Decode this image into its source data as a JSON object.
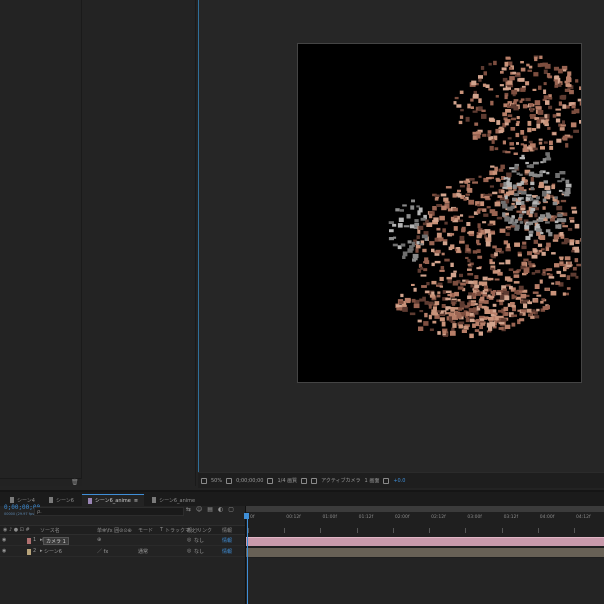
{
  "timeline": {
    "tabs": [
      {
        "label": "シーン4",
        "color": "#7a7a7a",
        "active": false
      },
      {
        "label": "シーン6",
        "color": "#7a7a7a",
        "active": false
      },
      {
        "label": "シーン6_anime",
        "color": "#9a86b5",
        "active": true
      },
      {
        "label": "シーン6_anime",
        "color": "#7a7a7a",
        "active": false
      }
    ],
    "timecode": "0;00;00;00",
    "fps": "00000 (29.97 fps)",
    "search_placeholder": "ρ.",
    "columns": [
      "ソース名",
      "单✻\\fx 囲⊘⊙⊕",
      "モード",
      "T",
      "トラックマット",
      "親とリンク",
      "情報"
    ],
    "layers": [
      {
        "index": "1",
        "name": "カメラ 1",
        "label_color": "#b07070",
        "mode": "",
        "parent": "なし",
        "info": "情報",
        "selected": true
      },
      {
        "index": "2",
        "name": "シーン6",
        "label_color": "#b8a47a",
        "mode": "通常",
        "parent": "なし",
        "info": "情報",
        "switch": "／ fx"
      }
    ],
    "ruler_ticks": [
      "0f",
      "00:12f",
      "01:00f",
      "01:12f",
      "02:00f",
      "02:12f",
      "03:00f",
      "03:12f",
      "04:00f",
      "04:12f"
    ],
    "track_colors": {
      "camera": "#c99aab",
      "footage": "#686156"
    }
  },
  "viewer_bar": {
    "zoom": "50%",
    "time": "0;00;00;00",
    "resolution": "1/4 画質",
    "camera": "アクティブカメラ",
    "views": "1 画面",
    "exposure": "+0.0"
  },
  "accent": "#3f8fd8"
}
